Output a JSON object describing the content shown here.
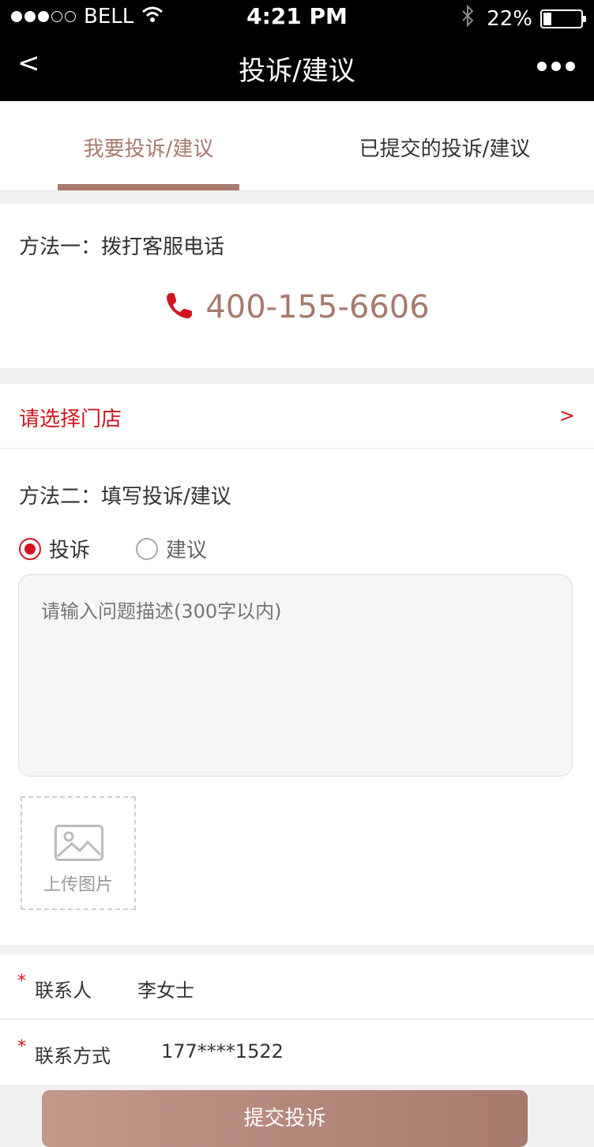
{
  "status_bar": {
    "carrier": "BELL",
    "time": "4:21 PM",
    "battery_text": "22%",
    "battery_level": 0.22
  },
  "nav": {
    "title": "投诉/建议",
    "back_label": "<"
  },
  "tabs": [
    {
      "label": "我要投诉/建议",
      "active": true
    },
    {
      "label": "已提交的投诉/建议",
      "active": false
    }
  ],
  "method1": {
    "title": "方法一：拨打客服电话",
    "phone": "400-155-6606"
  },
  "store_select": {
    "label": "请选择门店",
    "arrow": ">"
  },
  "method2": {
    "title": "方法二：填写投诉/建议",
    "options": [
      {
        "label": "投诉",
        "selected": true
      },
      {
        "label": "建议",
        "selected": false
      }
    ],
    "textarea_placeholder": "请输入问题描述(300字以内)",
    "upload_label": "上传图片"
  },
  "contact": {
    "required_mark": "*",
    "name_label": "联系人",
    "name_value": "李女士",
    "phone_label": "联系方式",
    "phone_value": "177****1522"
  },
  "submit_label": "提交投诉",
  "colors": {
    "accent": "#a77a6d",
    "alert": "#d2141e"
  },
  "icons": {
    "phone": "phone-icon",
    "upload": "image-icon",
    "more": "more-icon"
  }
}
